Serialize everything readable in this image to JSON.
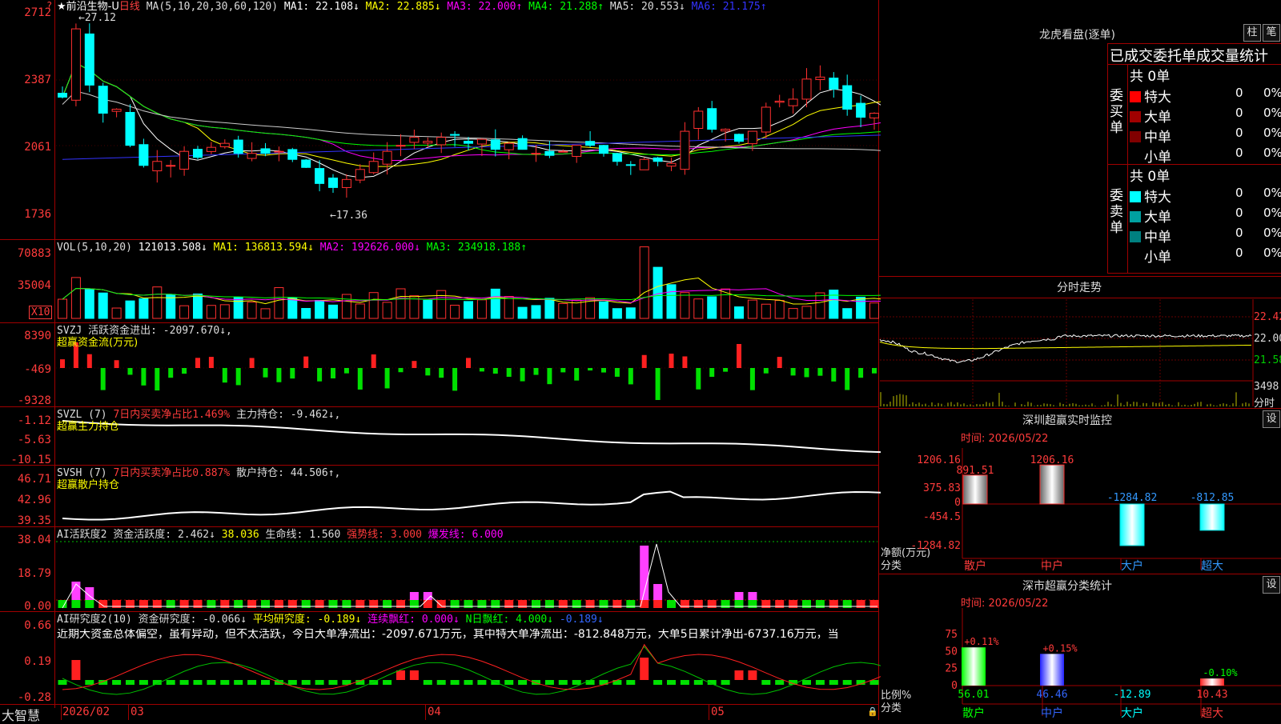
{
  "main": {
    "ticker": "★前沿生物-U",
    "period": "日线",
    "ma_params": "MA(5,10,20,30,60,120)",
    "ma_values": [
      {
        "label": "MA1: 22.108↓",
        "color": "#ffffff"
      },
      {
        "label": "MA2: 22.885↓",
        "color": "#ffff00"
      },
      {
        "label": "MA3: 22.000↑",
        "color": "#ff00ff"
      },
      {
        "label": "MA4: 21.288↑",
        "color": "#00ff00"
      },
      {
        "label": "MA5: 20.553↓",
        "color": "#dddddd"
      },
      {
        "label": "MA6: 21.175↑",
        "color": "#3333ff"
      }
    ],
    "yticks": [
      "2712",
      "2387",
      "2061",
      "1736"
    ],
    "high_label": "27.12",
    "low_label": "17.36",
    "corner_mark": "?"
  },
  "vol": {
    "header": "VOL(5,10,20)",
    "value": "121013.508↓",
    "ma1": "MA1: 136813.594↓",
    "ma2": "MA2: 192626.000↓",
    "ma3": "MA3: 234918.188↑",
    "yticks": [
      "70883",
      "35004"
    ],
    "unit": "X10"
  },
  "svzj": {
    "header": "SVZJ  活跃资金进出: -2097.670↓,",
    "sub": "超赢资金流(万元)",
    "yticks": [
      "8390",
      "-469",
      "-9328"
    ]
  },
  "svzl": {
    "header_a": "SVZL (7)",
    "header_b": "7日内买卖净占比1.469%",
    "header_c": "主力持仓: -9.462↓,",
    "sub": "超赢主力持仓",
    "yticks": [
      "-1.12",
      "-5.63",
      "-10.15"
    ]
  },
  "svsh": {
    "header_a": "SVSH (7)",
    "header_b": "7日内买卖净占比0.887%",
    "header_c": "散户持仓: 44.506↑,",
    "sub": "超赢散户持仓",
    "yticks": [
      "46.71",
      "42.96",
      "39.35"
    ]
  },
  "ai1": {
    "header_a": "AI活跃度2 资金活跃度: 2.462↓",
    "header_b": "38.036",
    "header_c": "生命线: 1.560",
    "header_d": "强势线: 3.000",
    "header_e": "爆发线: 6.000",
    "yticks": [
      "38.04",
      "18.79",
      "0.00"
    ]
  },
  "ai2": {
    "header_a": "AI研究度2(10) 资金研究度: -0.066↓",
    "header_b": "平均研究度: -0.189↓",
    "header_c": "连续飘红: 0.000↓",
    "header_d": "N日飘红: 4.000↓",
    "header_e": "-0.189↓",
    "text": "近期大资金总体偏空，虽有异动，但不太活跃，今日大单净流出：-2097.671万元，其中特大单净流出：-812.848万元，大单5日累计净出-6737.16万元，当",
    "yticks": [
      "0.66",
      "0.19",
      "-0.28"
    ]
  },
  "xaxis": {
    "brand": "大智慧",
    "labels": [
      "2026/02",
      "03",
      "04",
      "05"
    ]
  },
  "right": {
    "dragon_title": "龙虎看盘(逐单)",
    "btn_bar": "柱",
    "btn_pen": "笔",
    "stat_title": "已成交委托单成交量统计",
    "buy": {
      "side_label": "委买单",
      "count": "共 0单",
      "rows": [
        {
          "name": "特大",
          "val": "0",
          "pct": "0%",
          "color": "#ff0000"
        },
        {
          "name": "大单",
          "val": "0",
          "pct": "0%",
          "color": "#a00000"
        },
        {
          "name": "中单",
          "val": "0",
          "pct": "0%",
          "color": "#800000"
        },
        {
          "name": "小单",
          "val": "0",
          "pct": "0%",
          "color": "#000000"
        }
      ]
    },
    "sell": {
      "side_label": "委卖单",
      "count": "共 0单",
      "rows": [
        {
          "name": "特大",
          "val": "0",
          "pct": "0%",
          "color": "#00ffff"
        },
        {
          "name": "大单",
          "val": "0",
          "pct": "0%",
          "color": "#00a0a0"
        },
        {
          "name": "中单",
          "val": "0",
          "pct": "0%",
          "color": "#008080"
        },
        {
          "name": "小单",
          "val": "0",
          "pct": "0%",
          "color": "#000000"
        }
      ]
    },
    "intraday_title": "分时走势",
    "intraday_yticks": [
      "22.42",
      "22.00",
      "21.58"
    ],
    "intraday_vol": "3498",
    "intraday_vol_unit": "分时",
    "sz_title": "深圳超赢实时监控",
    "sz_btn": "设",
    "sz_time": "时间: 2026/05/22",
    "sz_yticks": [
      "1206.16",
      "375.83",
      "0",
      "-454.5",
      "-1284.82"
    ],
    "sz_ylabel": "净额(万元)",
    "sz_xlabel": "分类",
    "sz_bars": [
      {
        "cat": "散户",
        "value": 891.51,
        "label": "891.51"
      },
      {
        "cat": "中户",
        "value": 1206.16,
        "label": "1206.16"
      },
      {
        "cat": "大户",
        "value": -1284.82,
        "label": "-1284.82"
      },
      {
        "cat": "超大",
        "value": -812.85,
        "label": "-812.85"
      }
    ],
    "cls_title": "深市超赢分类统计",
    "cls_btn": "设",
    "cls_time": "时间: 2026/05/22",
    "cls_yticks": [
      "75",
      "50",
      "25",
      "0"
    ],
    "cls_ylabel": "比例%",
    "cls_xlabel": "分类",
    "cls_bars": [
      {
        "cat": "散户",
        "value": 56.01,
        "label": "56.01",
        "top": "+0.11%"
      },
      {
        "cat": "中户",
        "value": 46.46,
        "label": "46.46",
        "top": "+0.15%"
      },
      {
        "cat": "大户",
        "value": -12.89,
        "label": "-12.89",
        "top": ""
      },
      {
        "cat": "超大",
        "value": 10.43,
        "label": "10.43",
        "top": "-0.10%"
      }
    ]
  }
}
